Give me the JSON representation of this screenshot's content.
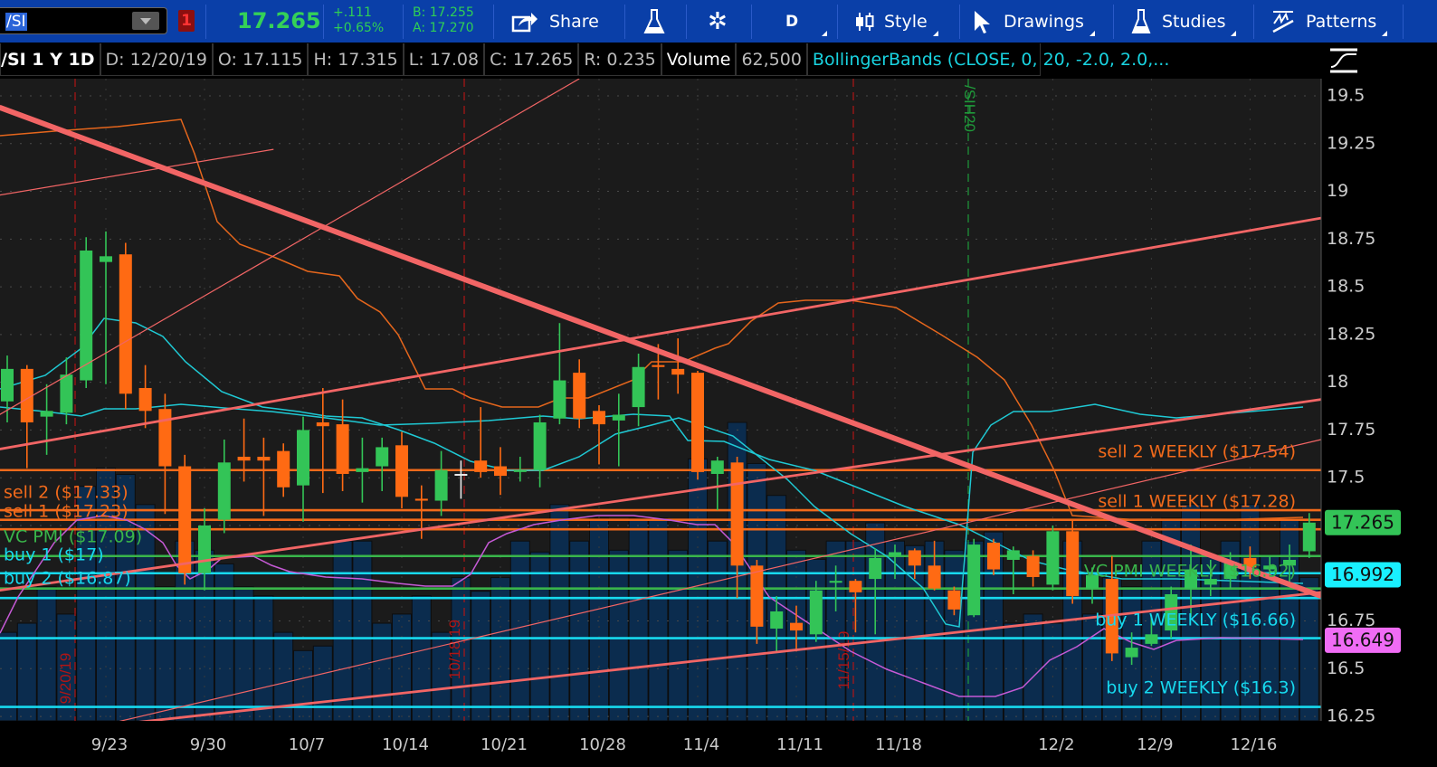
{
  "toolbar": {
    "symbol": "/SI",
    "alert_count": "1",
    "last_price": "17.265",
    "net_change": "+.111",
    "pct_change": "+0.65%",
    "bid": "B: 17.255",
    "ask": "A: 17.270",
    "share_label": "Share",
    "period_label": "D",
    "style_label": "Style",
    "drawings_label": "Drawings",
    "studies_label": "Studies",
    "patterns_label": "Patterns"
  },
  "info": {
    "title": "/SI 1 Y 1D",
    "date": "D: 12/20/19",
    "open": "O: 17.115",
    "high": "H: 17.315",
    "low": "L: 17.08",
    "close": "C: 17.265",
    "range": "R: 0.235",
    "volume_label": "Volume",
    "volume_value": "62,500",
    "study": "BollingerBands (CLOSE, 0, 20, -2.0, 2.0,..."
  },
  "colors": {
    "up": "#33c457",
    "down": "#ff6a13",
    "doji": "#e8e8e8",
    "volume": "#0b2c4e",
    "sell": "#f26a1b",
    "pmi": "#39b54a",
    "buy": "#17d9ee",
    "trend": "#f26565"
  },
  "chart_data": {
    "type": "candlestick",
    "symbol": "/SI",
    "ylim": [
      16.2,
      19.6
    ],
    "y_ticks": [
      "19.5",
      "19.25",
      "19",
      "18.75",
      "18.5",
      "18.25",
      "18",
      "17.75",
      "17.5",
      "16.75",
      "16.5",
      "16.25"
    ],
    "y_tick_values": [
      19.5,
      19.25,
      19,
      18.75,
      18.5,
      18.25,
      18,
      17.75,
      17.5,
      16.75,
      16.5,
      16.25
    ],
    "x_ticks": [
      {
        "label": "9/23",
        "bar": 5
      },
      {
        "label": "9/30",
        "bar": 10
      },
      {
        "label": "10/7",
        "bar": 15
      },
      {
        "label": "10/14",
        "bar": 20
      },
      {
        "label": "10/21",
        "bar": 25
      },
      {
        "label": "10/28",
        "bar": 30
      },
      {
        "label": "11/4",
        "bar": 35
      },
      {
        "label": "11/11",
        "bar": 40
      },
      {
        "label": "11/18",
        "bar": 45
      },
      {
        "label": "12/2",
        "bar": 53
      },
      {
        "label": "12/9",
        "bar": 58
      },
      {
        "label": "12/16",
        "bar": 63
      }
    ],
    "candles_ohlc": [
      [
        17.9,
        18.14,
        17.79,
        18.07
      ],
      [
        18.07,
        18.09,
        17.55,
        17.79
      ],
      [
        17.82,
        17.99,
        17.62,
        17.85
      ],
      [
        17.84,
        18.13,
        17.78,
        18.04
      ],
      [
        18.01,
        18.76,
        17.97,
        18.69
      ],
      [
        18.63,
        18.79,
        17.99,
        18.66
      ],
      [
        18.67,
        18.73,
        17.86,
        17.94
      ],
      [
        17.97,
        18.09,
        17.76,
        17.85
      ],
      [
        17.86,
        17.94,
        17.31,
        17.56
      ],
      [
        17.56,
        17.62,
        16.94,
        17.0
      ],
      [
        17.0,
        17.34,
        16.91,
        17.25
      ],
      [
        17.28,
        17.7,
        17.21,
        17.58
      ],
      [
        17.61,
        17.81,
        17.48,
        17.59
      ],
      [
        17.61,
        17.71,
        17.3,
        17.59
      ],
      [
        17.64,
        17.68,
        17.4,
        17.45
      ],
      [
        17.46,
        17.82,
        17.27,
        17.75
      ],
      [
        17.79,
        17.97,
        17.42,
        17.77
      ],
      [
        17.78,
        17.91,
        17.43,
        17.52
      ],
      [
        17.53,
        17.71,
        17.37,
        17.55
      ],
      [
        17.56,
        17.71,
        17.43,
        17.66
      ],
      [
        17.67,
        17.74,
        17.34,
        17.4
      ],
      [
        17.39,
        17.46,
        17.18,
        17.38
      ],
      [
        17.38,
        17.64,
        17.3,
        17.54
      ],
      [
        17.52,
        17.59,
        17.39,
        17.52
      ],
      [
        17.59,
        17.87,
        17.5,
        17.53
      ],
      [
        17.56,
        17.66,
        17.41,
        17.51
      ],
      [
        17.53,
        17.61,
        17.48,
        17.54
      ],
      [
        17.54,
        17.83,
        17.45,
        17.79
      ],
      [
        17.81,
        18.31,
        17.78,
        18.01
      ],
      [
        18.05,
        18.12,
        17.76,
        17.81
      ],
      [
        17.85,
        17.88,
        17.57,
        17.78
      ],
      [
        17.8,
        17.94,
        17.56,
        17.83
      ],
      [
        17.87,
        18.15,
        17.77,
        18.08
      ],
      [
        18.09,
        18.2,
        17.91,
        18.08
      ],
      [
        18.07,
        18.23,
        17.94,
        18.04
      ],
      [
        18.05,
        18.06,
        17.49,
        17.53
      ],
      [
        17.52,
        17.61,
        17.33,
        17.59
      ],
      [
        17.58,
        17.61,
        16.87,
        17.04
      ],
      [
        17.04,
        17.07,
        16.63,
        16.72
      ],
      [
        16.71,
        16.88,
        16.59,
        16.8
      ],
      [
        16.74,
        16.83,
        16.59,
        16.7
      ],
      [
        16.68,
        16.96,
        16.64,
        16.91
      ],
      [
        16.95,
        17.04,
        16.8,
        16.96
      ],
      [
        16.96,
        16.97,
        16.69,
        16.9
      ],
      [
        16.97,
        17.13,
        16.68,
        17.08
      ],
      [
        17.09,
        17.15,
        16.97,
        17.11
      ],
      [
        17.12,
        17.13,
        16.97,
        17.04
      ],
      [
        17.04,
        17.17,
        16.91,
        16.92
      ],
      [
        16.91,
        16.93,
        16.78,
        16.81
      ],
      [
        16.78,
        17.18,
        16.77,
        17.15
      ],
      [
        17.16,
        17.18,
        16.99,
        17.02
      ],
      [
        17.07,
        17.14,
        16.89,
        17.12
      ],
      [
        17.09,
        17.12,
        16.93,
        16.98
      ],
      [
        16.94,
        17.25,
        16.91,
        17.22
      ],
      [
        17.22,
        17.28,
        16.84,
        16.88
      ],
      [
        16.92,
        17.03,
        16.84,
        16.99
      ],
      [
        16.97,
        17.09,
        16.54,
        16.58
      ],
      [
        16.56,
        16.69,
        16.52,
        16.61
      ],
      [
        16.63,
        16.78,
        16.62,
        16.68
      ],
      [
        16.7,
        16.93,
        16.66,
        16.89
      ],
      [
        16.92,
        17.15,
        16.77,
        17.02
      ],
      [
        16.94,
        17.07,
        16.88,
        16.97
      ],
      [
        16.97,
        17.11,
        16.92,
        17.06
      ],
      [
        17.08,
        17.14,
        16.97,
        17.03
      ],
      [
        17.02,
        17.09,
        16.97,
        17.04
      ],
      [
        17.04,
        17.15,
        16.93,
        17.07
      ],
      [
        17.115,
        17.315,
        17.08,
        17.265
      ]
    ],
    "volume_relative": [
      97,
      107,
      147,
      117,
      257,
      277,
      270,
      237,
      147,
      197,
      187,
      172,
      147,
      137,
      97,
      77,
      82,
      197,
      197,
      107,
      117,
      137,
      97,
      157,
      142,
      157,
      197,
      185,
      237,
      197,
      222,
      187,
      222,
      222,
      187,
      287,
      197,
      327,
      282,
      247,
      187,
      177,
      197,
      197,
      217,
      197,
      192,
      197,
      187,
      197,
      207,
      107,
      117,
      107,
      197,
      117,
      157,
      147,
      197,
      222,
      237,
      182,
      197,
      237,
      182,
      222,
      157
    ],
    "levels": [
      {
        "label": "sell 2 WEEKLY ($17.54)",
        "price": 17.54,
        "kind": "sell",
        "side": "right"
      },
      {
        "label": "sell 2 ($17.33)",
        "price": 17.33,
        "kind": "sell",
        "side": "left"
      },
      {
        "label": "sell 1 WEEKLY ($17.28)",
        "price": 17.28,
        "kind": "sell",
        "side": "right"
      },
      {
        "label": "sell 1 ($17.23)",
        "price": 17.23,
        "kind": "sell",
        "side": "left"
      },
      {
        "label": "VC PMI ($17.09)",
        "price": 17.09,
        "kind": "pmi",
        "side": "left"
      },
      {
        "label": "buy 1 ($17)",
        "price": 17.0,
        "kind": "buy",
        "side": "left"
      },
      {
        "label": "VC PMI WEEKLY ($16.92)",
        "price": 16.92,
        "kind": "pmi",
        "side": "right"
      },
      {
        "label": "buy 2 ($16.87)",
        "price": 16.87,
        "kind": "buy",
        "side": "left"
      },
      {
        "label": "buy 1 WEEKLY ($16.66)",
        "price": 16.66,
        "kind": "buy",
        "side": "right"
      },
      {
        "label": "buy 2 WEEKLY ($16.3)",
        "price": 16.3,
        "kind": "buy",
        "side": "right"
      }
    ],
    "trendlines": [
      {
        "from": [
          -0.4,
          19.44
        ],
        "to": [
          66.6,
          16.88
        ],
        "weight": "heavy"
      },
      {
        "from": [
          -0.4,
          17.65
        ],
        "to": [
          66.6,
          18.86
        ],
        "weight": "medium"
      },
      {
        "from": [
          -0.4,
          16.91
        ],
        "to": [
          66.6,
          17.91
        ],
        "weight": "medium"
      },
      {
        "from": [
          -0.4,
          16.14
        ],
        "to": [
          66.6,
          16.9
        ],
        "weight": "medium"
      },
      {
        "from": [
          -0.4,
          18.98
        ],
        "to": [
          13.5,
          19.22
        ],
        "weight": "thin"
      },
      {
        "from": [
          -0.4,
          17.83
        ],
        "to": [
          29.0,
          19.59
        ],
        "weight": "thin"
      },
      {
        "from": [
          5.1,
          16.21
        ],
        "to": [
          66.6,
          17.7
        ],
        "weight": "thin"
      }
    ],
    "event_markers": [
      {
        "label": "9/20/19",
        "color": "#b01515"
      },
      {
        "label": "10/18/19",
        "color": "#b01515"
      },
      {
        "label": "11/15/19",
        "color": "#b01515"
      },
      {
        "label": "/SIH20",
        "color": "#1f9a3a"
      }
    ],
    "price_badges": [
      {
        "value": "17.265",
        "price": 17.265,
        "color": "#33c457"
      },
      {
        "value": "16.992",
        "price": 16.992,
        "color": "#19f0ff"
      },
      {
        "value": "16.649",
        "price": 16.649,
        "color": "#f06cf5"
      }
    ]
  }
}
